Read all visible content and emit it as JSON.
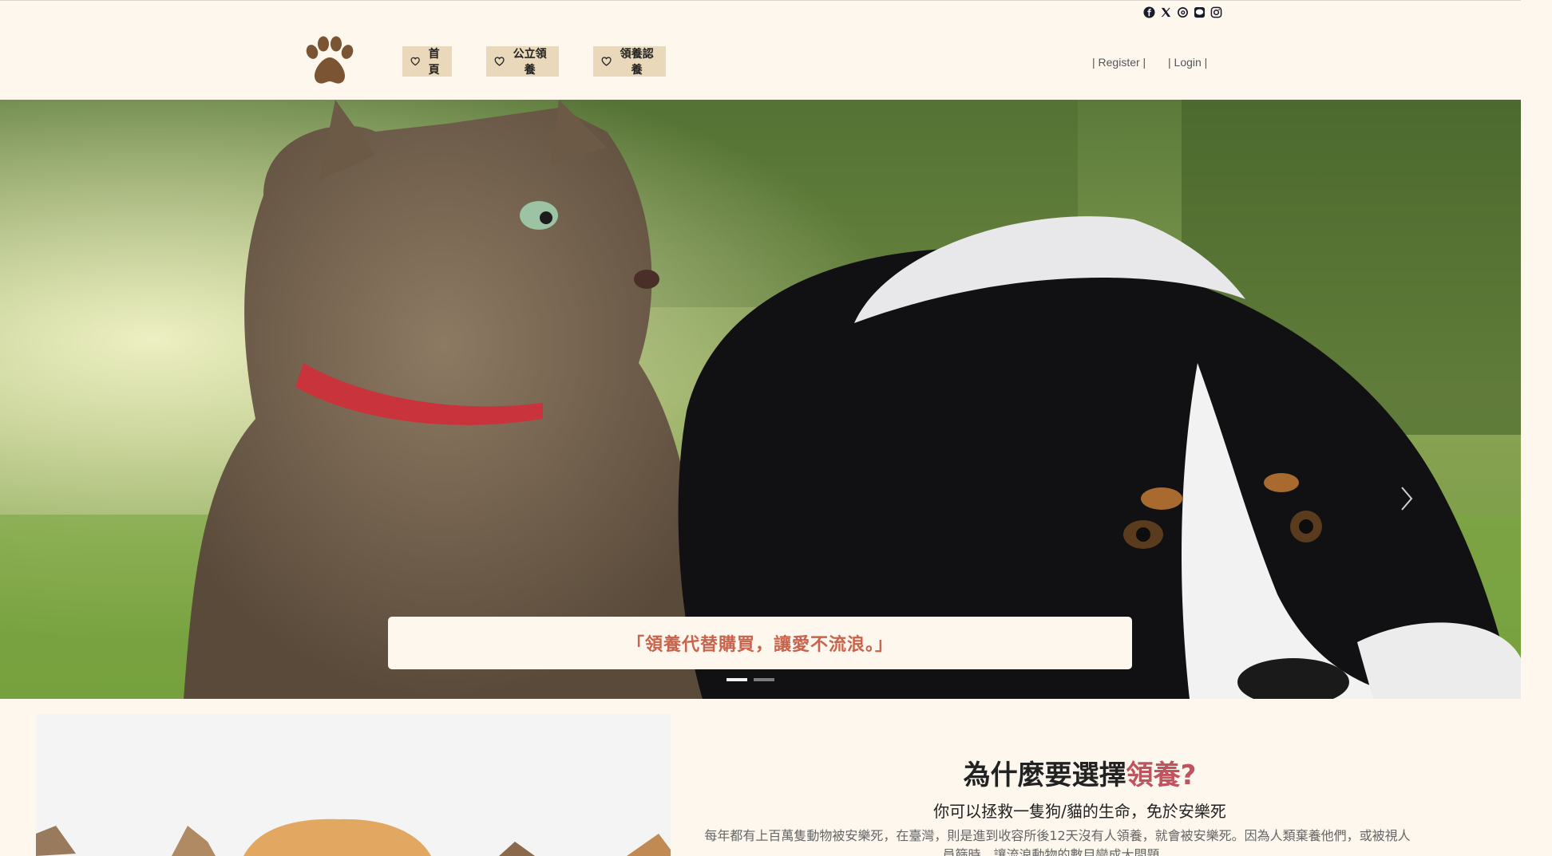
{
  "social": {
    "icons": [
      "facebook-icon",
      "x-icon",
      "threads-icon",
      "line-icon",
      "instagram-icon"
    ]
  },
  "header": {
    "logo_icon": "paw-icon",
    "nav": [
      {
        "label": "首頁",
        "icon": "heart-icon"
      },
      {
        "label": "公立領養",
        "icon": "heart-icon"
      },
      {
        "label": "領養認養",
        "icon": "heart-icon"
      }
    ],
    "register_label": "| Register |",
    "login_label": "| Login |"
  },
  "hero": {
    "caption": "「領養代替購買，讓愛不流浪。」",
    "slide_count": 2,
    "active_slide": 1
  },
  "why": {
    "title_main": "為什麼要選擇",
    "title_accent": "領養?",
    "subtitle": "你可以拯救一隻狗/貓的生命，免於安樂死",
    "body": "每年都有上百萬隻動物被安樂死，在臺灣，則是進到收容所後12天沒有人領養，就會被安樂死。因為人類棄養他們，或被視人員篩時，讓流浪動物的數目變成大問題。"
  },
  "colors": {
    "background": "#fdf7ee",
    "nav_button": "#ead8bb",
    "accent_red": "#c0535d",
    "caption_text": "#c8634d",
    "logo_brown": "#7a5433"
  }
}
